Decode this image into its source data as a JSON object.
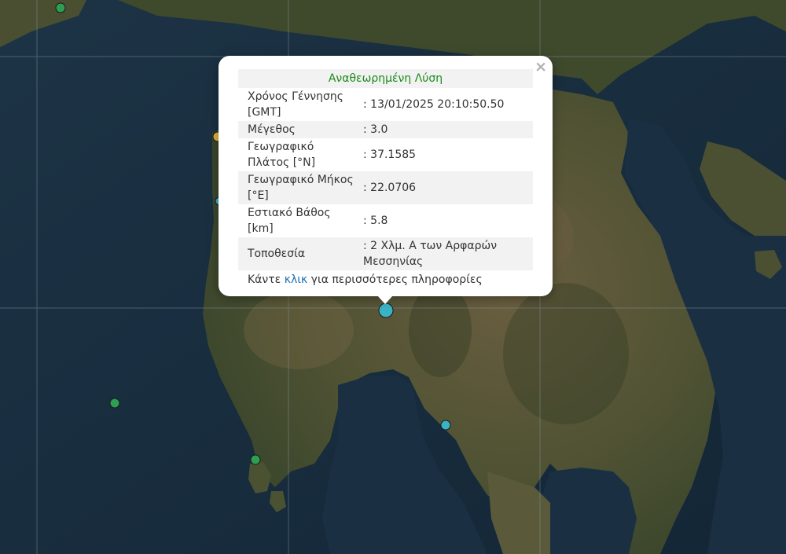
{
  "popup": {
    "title": "Αναθεωρημένη Λύση",
    "close_symbol": "×",
    "rows": [
      {
        "label": "Χρόνος Γέννησης [GMT]",
        "value": ": 13/01/2025 20:10:50.50"
      },
      {
        "label": "Μέγεθος",
        "value": ": 3.0"
      },
      {
        "label": "Γεωγραφικό Πλάτος [°N]",
        "value": ": 37.1585"
      },
      {
        "label": "Γεωγραφικό Μήκος [°E]",
        "value": ": 22.0706"
      },
      {
        "label": "Εστιακό Βάθος [km]",
        "value": ": 5.8"
      },
      {
        "label": "Τοποθεσία",
        "value": ": 2 Χλμ. Α των Αρφαρών Μεσσηνίας"
      }
    ],
    "more_prefix": "Κάντε ",
    "more_link": "κλικ",
    "more_suffix": " για περισσότερες πληροφορίες"
  },
  "markers": [
    {
      "id": "selected-event",
      "color": "#3ab3c7",
      "size": "large"
    },
    {
      "id": "event-1",
      "color": "#2e9e52",
      "size": "small"
    },
    {
      "id": "event-2",
      "color": "#e0b23a",
      "size": "small"
    },
    {
      "id": "event-3",
      "color": "#3ab3c7",
      "size": "small"
    },
    {
      "id": "event-4",
      "color": "#2e9e52",
      "size": "small"
    },
    {
      "id": "event-5",
      "color": "#3ab3c7",
      "size": "small"
    },
    {
      "id": "event-6",
      "color": "#2e9e52",
      "size": "small"
    }
  ],
  "colors": {
    "sea": "#152a3a",
    "land_dark": "#3d4a2c",
    "land_light": "#6a5e40",
    "graticule": "#8a96a0"
  }
}
